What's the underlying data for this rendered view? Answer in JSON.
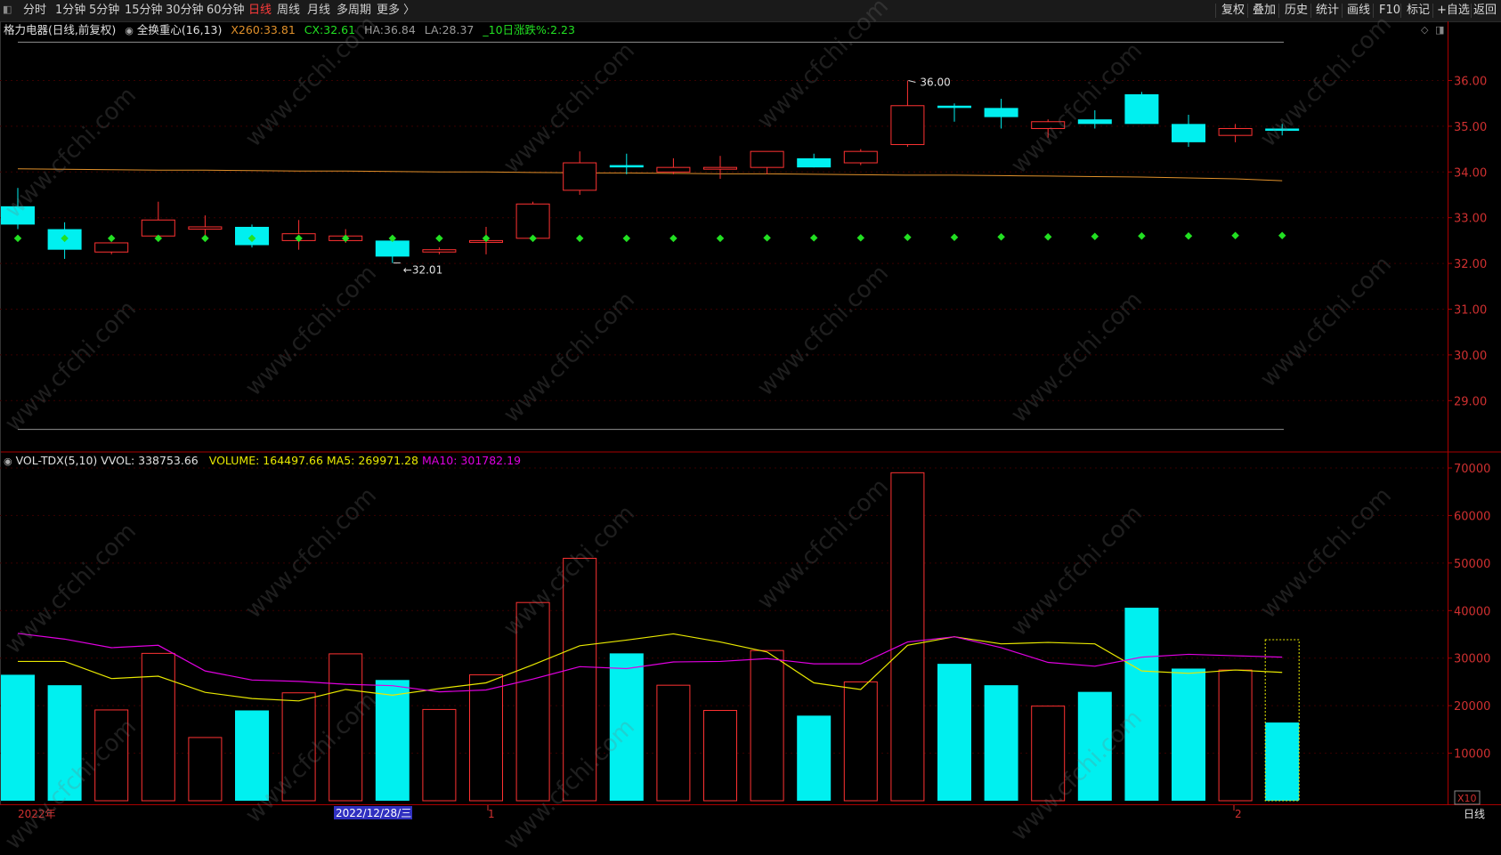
{
  "toolbar": {
    "periods": [
      "分时",
      "1分钟",
      "5分钟",
      "15分钟",
      "30分钟",
      "60分钟",
      "日线",
      "周线",
      "月线",
      "多周期",
      "更多 〉"
    ],
    "active_period": "日线",
    "right_items": [
      "复权",
      "叠加",
      "历史",
      "统计",
      "画线",
      "F10",
      "标记",
      "+自选",
      "返回"
    ]
  },
  "main_panel": {
    "stock_title": "格力电器(日线,前复权)",
    "indicator_name": "全换重心(16,13)",
    "indicators": [
      {
        "label": "X260:",
        "value": "33.81",
        "color": "#e0902a"
      },
      {
        "label": "CX:",
        "value": "32.61",
        "color": "#22e022"
      },
      {
        "label": "HA:",
        "value": "36.84",
        "color": "#9a9a9a"
      },
      {
        "label": "LA:",
        "value": "28.37",
        "color": "#9a9a9a"
      },
      {
        "label": "_10日涨跌%:",
        "value": "2.23",
        "color": "#22e022"
      }
    ],
    "high_marker": "36.00",
    "low_marker": "32.01"
  },
  "volume_panel": {
    "indicator_name": "VOL-TDX(5,10)",
    "vvol_label": "VVOL:",
    "vvol_value": "338753.66",
    "volume_label": "VOLUME:",
    "volume_value": "164497.66",
    "ma5_label": "MA5:",
    "ma5_value": "269971.28",
    "ma10_label": "MA10:",
    "ma10_value": "301782.19",
    "scale_badge": "X10"
  },
  "colors": {
    "up": "#ff3232",
    "down": "#00f0f0",
    "ma5": "#e8e800",
    "ma10": "#e000e0",
    "x260": "#e0902a",
    "cx": "#22e022",
    "frame": "#aa0000",
    "band": "#909090",
    "axis_text": "#d03030"
  },
  "price_axis": [
    "36.00",
    "35.00",
    "34.00",
    "33.00",
    "32.00",
    "31.00",
    "30.00",
    "29.00"
  ],
  "volume_axis": [
    "70000",
    "60000",
    "50000",
    "40000",
    "30000",
    "20000",
    "10000"
  ],
  "date_axis": {
    "start_label": "2022年",
    "highlight_label": "2022/12/28/三",
    "month_1": "1",
    "month_2": "2",
    "period_label": "日线"
  },
  "watermark": "www.cfchi.com",
  "chart_data": {
    "type": "candlestick",
    "title": "格力电器(日线,前复权)",
    "series": [
      {
        "name": "candles",
        "ohlc": [
          [
            33.25,
            33.65,
            32.75,
            32.85
          ],
          [
            32.75,
            32.9,
            32.1,
            32.3
          ],
          [
            32.25,
            32.45,
            32.2,
            32.45
          ],
          [
            32.6,
            33.35,
            32.55,
            32.95
          ],
          [
            32.75,
            33.05,
            32.55,
            32.8
          ],
          [
            32.8,
            32.85,
            32.35,
            32.4
          ],
          [
            32.5,
            32.95,
            32.3,
            32.65
          ],
          [
            32.5,
            32.75,
            32.45,
            32.6
          ],
          [
            32.5,
            32.55,
            32.01,
            32.15
          ],
          [
            32.25,
            32.35,
            32.2,
            32.3
          ],
          [
            32.5,
            32.8,
            32.2,
            32.5
          ],
          [
            32.55,
            33.35,
            32.55,
            33.3
          ],
          [
            33.6,
            34.45,
            33.5,
            34.2
          ],
          [
            34.15,
            34.4,
            33.95,
            34.1
          ],
          [
            34.0,
            34.3,
            33.95,
            34.1
          ],
          [
            34.1,
            34.35,
            33.85,
            34.1
          ],
          [
            34.1,
            34.45,
            33.95,
            34.45
          ],
          [
            34.3,
            34.4,
            34.1,
            34.1
          ],
          [
            34.2,
            34.5,
            34.15,
            34.45
          ],
          [
            34.6,
            36.0,
            34.55,
            35.45
          ],
          [
            35.45,
            35.5,
            35.1,
            35.4
          ],
          [
            35.4,
            35.6,
            34.95,
            35.2
          ],
          [
            34.95,
            35.15,
            34.75,
            35.1
          ],
          [
            35.15,
            35.35,
            34.95,
            35.05
          ],
          [
            35.7,
            35.75,
            35.05,
            35.05
          ],
          [
            35.05,
            35.25,
            34.55,
            34.65
          ],
          [
            34.8,
            35.05,
            34.65,
            34.95
          ],
          [
            34.95,
            35.05,
            34.8,
            34.9
          ]
        ]
      },
      {
        "name": "X260",
        "values": [
          34.07,
          34.06,
          34.05,
          34.04,
          34.04,
          34.03,
          34.02,
          34.02,
          34.01,
          34.0,
          34.0,
          33.99,
          33.98,
          33.98,
          33.97,
          33.96,
          33.96,
          33.95,
          33.94,
          33.93,
          33.93,
          33.92,
          33.91,
          33.9,
          33.89,
          33.87,
          33.85,
          33.81
        ]
      },
      {
        "name": "CX",
        "values": [
          32.55,
          32.55,
          32.55,
          32.55,
          32.55,
          32.55,
          32.55,
          32.55,
          32.55,
          32.55,
          32.55,
          32.55,
          32.55,
          32.55,
          32.55,
          32.55,
          32.56,
          32.56,
          32.56,
          32.57,
          32.57,
          32.58,
          32.58,
          32.59,
          32.6,
          32.6,
          32.61,
          32.61
        ]
      },
      {
        "name": "HA",
        "values": [
          36.84,
          36.84
        ]
      },
      {
        "name": "LA",
        "values": [
          28.37,
          28.37
        ]
      },
      {
        "name": "VOLUME",
        "values": [
          26500,
          24300,
          19100,
          31000,
          13300,
          19000,
          22700,
          30900,
          25400,
          19200,
          26500,
          41700,
          51000,
          31000,
          24300,
          19000,
          31600,
          17900,
          25000,
          69000,
          28800,
          24300,
          19900,
          22900,
          40600,
          27800,
          27500,
          16450
        ]
      },
      {
        "name": "MA5",
        "values": [
          29300,
          29300,
          25700,
          26200,
          22800,
          21500,
          21000,
          23400,
          22200,
          23600,
          24800,
          28600,
          32600,
          33800,
          35100,
          33400,
          31300,
          24800,
          23400,
          32700,
          34500,
          33000,
          33300,
          33000,
          27300,
          26800,
          27500,
          27000
        ]
      },
      {
        "name": "MA10",
        "values": [
          35200,
          34000,
          32200,
          32700,
          27300,
          25400,
          25100,
          24500,
          24200,
          22900,
          23300,
          25600,
          28200,
          27800,
          29200,
          29300,
          29900,
          28800,
          28800,
          33400,
          34500,
          32200,
          29100,
          28300,
          30200,
          30800,
          30500,
          30200
        ]
      }
    ],
    "ylim": [
      28.2,
      36.9
    ],
    "volume_ylim": [
      0,
      72800
    ],
    "y_ticks": [
      29,
      30,
      31,
      32,
      33,
      34,
      35,
      36
    ],
    "volume_ticks": [
      10000,
      20000,
      30000,
      40000,
      50000,
      60000,
      70000
    ]
  }
}
